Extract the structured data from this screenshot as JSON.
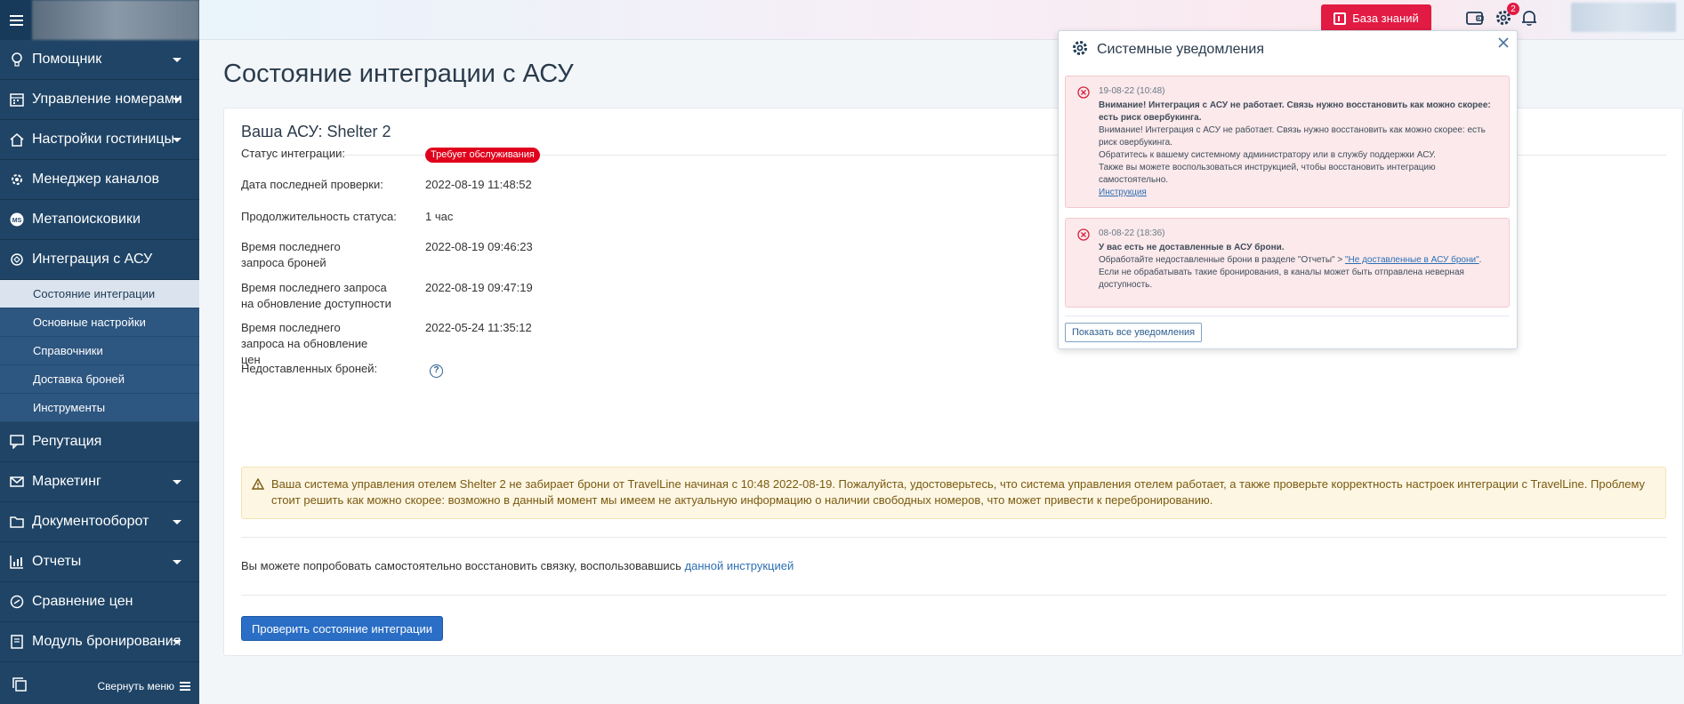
{
  "sidebar": {
    "collapse_label": "Свернуть меню",
    "items": [
      {
        "label": "Помощник",
        "icon": "lightbulb-icon",
        "caret": true
      },
      {
        "label": "Управление номерами",
        "icon": "calendar-icon",
        "caret": true
      },
      {
        "label": "Настройки гостиницы",
        "icon": "home-icon",
        "caret": true
      },
      {
        "label": "Менеджер каналов",
        "icon": "gear-icon",
        "caret": false
      },
      {
        "label": "Метапоисковики",
        "icon": "ms-icon",
        "caret": false
      },
      {
        "label": "Интеграция с АСУ",
        "icon": "integration-icon",
        "caret": false
      }
    ],
    "sub_items": [
      {
        "label": "Состояние интеграции",
        "active": true
      },
      {
        "label": "Основные настройки",
        "active": false
      },
      {
        "label": "Справочники",
        "active": false
      },
      {
        "label": "Доставка броней",
        "active": false
      },
      {
        "label": "Инструменты",
        "active": false
      }
    ],
    "items_after": [
      {
        "label": "Репутация",
        "icon": "chat-icon",
        "caret": false
      },
      {
        "label": "Маркетинг",
        "icon": "mail-icon",
        "caret": true
      },
      {
        "label": "Документооборот",
        "icon": "folder-icon",
        "caret": true
      },
      {
        "label": "Отчеты",
        "icon": "chart-icon",
        "caret": true
      },
      {
        "label": "Сравнение цен",
        "icon": "compare-icon",
        "caret": false
      },
      {
        "label": "Модуль бронирования",
        "icon": "booking-icon",
        "caret": true
      }
    ]
  },
  "topbar": {
    "knowledge_base_label": "База знаний",
    "notification_badge": "2"
  },
  "main": {
    "title": "Состояние интеграции с АСУ",
    "card_title": "Ваша АСУ: Shelter 2",
    "rows": [
      {
        "label": "Статус интеграции:",
        "value": "Требует обслуживания"
      },
      {
        "label": "Дата последней проверки:",
        "value": "2022-08-19 11:48:52"
      },
      {
        "label": "Продолжительность статуса:",
        "value": "1 час"
      },
      {
        "label": "Время последнего запроса броней",
        "value": "2022-08-19 09:46:23"
      },
      {
        "label": "Время последнего запроса на обновление доступности",
        "value": "2022-08-19 09:47:19"
      },
      {
        "label": "Время последнего запроса на обновление цен",
        "value": "2022-05-24 11:35:12"
      },
      {
        "label": "Недоставленных броней:",
        "value": "?"
      }
    ],
    "warning": "Ваша система управления отелем Shelter 2 не забирает брони от TravelLine начиная с 10:48 2022-08-19. Пожалуйста, удостоверьтесь, что система управления отелем работает, а также проверьте корректность настроек интеграции с TravelLine. Проблему стоит решить как можно скорее: возможно в данный момент мы имеем не актуальную информацию о наличии свободных номеров, что может привести к перебронированию.",
    "restore_text": "Вы можете попробовать самостоятельно восстановить связку, воспользовавшись ",
    "restore_link": "данной инструкцией",
    "check_button": "Проверить состояние интеграции"
  },
  "notifications": {
    "title": "Системные уведомления",
    "show_all": "Показать все уведомления",
    "items": [
      {
        "date": "19-08-22 (10:48)",
        "headline": "Внимание! Интеграция с АСУ не работает. Связь нужно восстановить как можно скорее: есть риск овербукинга.",
        "body1": "Внимание! Интеграция с АСУ не работает. Связь нужно восстановить как можно скорее: есть риск овербукинга.",
        "body2": "Обратитесь к вашему системному администратору или в службу поддержки АСУ.",
        "body3": "Также вы можете воспользоваться инструкцией, чтобы восстановить интеграцию самостоятельно.",
        "link": "Инструкция"
      },
      {
        "date": "08-08-22 (18:36)",
        "headline": "У вас есть не доставленные в АСУ брони.",
        "body1_pre": "Обработайте недоставленные брони в разделе \"Отчеты\" > ",
        "body1_link": "\"Не доставленные в АСУ брони\"",
        "body1_post": ".",
        "body2": "Если не обрабатывать такие бронирования, в каналы может быть отправлена неверная доступность."
      }
    ]
  },
  "colors": {
    "sidebar": "#1f4466",
    "accent_red": "#e21b44",
    "primary_button": "#2a6ec6"
  }
}
